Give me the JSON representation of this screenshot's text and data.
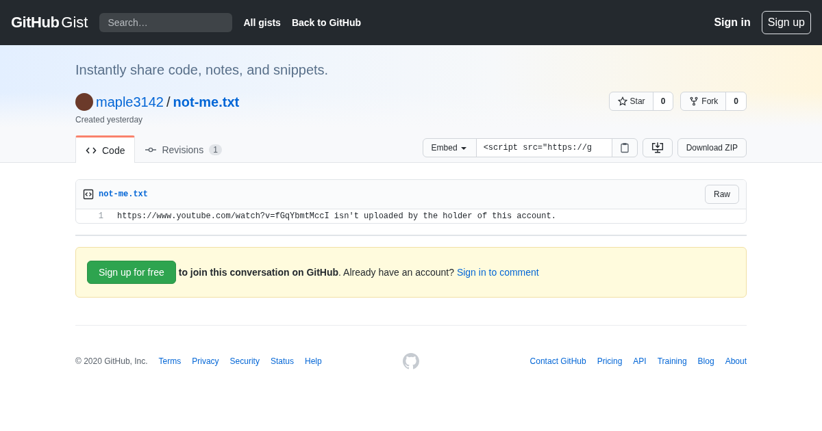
{
  "header": {
    "logo": "GitHub",
    "logo_suffix": "Gist",
    "search": {
      "placeholder": "Search…"
    },
    "nav": [
      "All gists",
      "Back to GitHub"
    ],
    "sign_in": "Sign in",
    "sign_up": "Sign up"
  },
  "hero": {
    "tagline": "Instantly share code, notes, and snippets.",
    "owner": "maple3142",
    "separator": "/",
    "gist_name": "not-me.txt",
    "created": "Created yesterday",
    "actions": [
      {
        "kind": "star",
        "label": "Star",
        "count": "0"
      },
      {
        "kind": "fork",
        "label": "Fork",
        "count": "0"
      }
    ]
  },
  "tabs": [
    {
      "kind": "code",
      "label": "Code",
      "selected": true
    },
    {
      "kind": "revisions",
      "label": "Revisions",
      "counter": "1",
      "selected": false
    }
  ],
  "toolbar": {
    "embed": "Embed",
    "embed_value": "<script src=\"https://g",
    "download": "Download ZIP"
  },
  "file": {
    "name": "not-me.txt",
    "raw": "Raw",
    "lines": [
      {
        "number": "1",
        "code": "https://www.youtube.com/watch?v=fGqYbmtMccI isn't uploaded by the holder of this account."
      }
    ]
  },
  "signup": {
    "button": "Sign up for free",
    "message": "**to join this conversation on GitHub**. Already have an account?",
    "link": "Sign in to comment"
  },
  "footer": {
    "copyright": "© 2020 GitHub, Inc.",
    "left_links": [
      "Terms",
      "Privacy",
      "Security",
      "Status",
      "Help"
    ],
    "right_links": [
      "Contact GitHub",
      "Pricing",
      "API",
      "Training",
      "Blog",
      "About"
    ]
  }
}
